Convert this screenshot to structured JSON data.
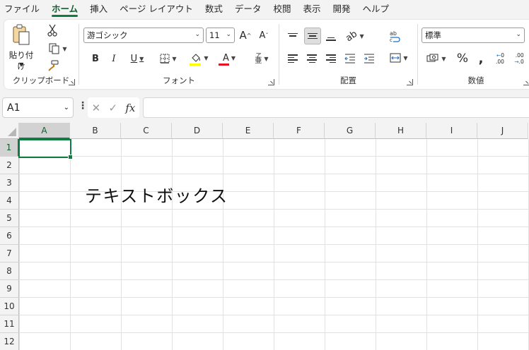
{
  "menu": {
    "tabs": [
      "ファイル",
      "ホーム",
      "挿入",
      "ページ レイアウト",
      "数式",
      "データ",
      "校閲",
      "表示",
      "開発",
      "ヘルプ"
    ],
    "active_tab": "ホーム"
  },
  "ribbon": {
    "clipboard": {
      "paste_label": "貼り付け",
      "group_label": "クリップボード"
    },
    "font": {
      "font_name": "游ゴシック",
      "font_size": "11",
      "group_label": "フォント"
    },
    "alignment": {
      "group_label": "配置"
    },
    "number": {
      "format": "標準",
      "group_label": "数値"
    }
  },
  "formula_bar": {
    "name_box": "A1",
    "fx_label": "fx",
    "content": ""
  },
  "sheet": {
    "columns": [
      "A",
      "B",
      "C",
      "D",
      "E",
      "F",
      "G",
      "H",
      "I",
      "J"
    ],
    "rows": [
      "1",
      "2",
      "3",
      "4",
      "5",
      "6",
      "7",
      "8",
      "9",
      "10",
      "11",
      "12"
    ],
    "selected_cell": "A1",
    "textbox_text": "テキストボックス"
  },
  "colors": {
    "accent": "#107c41",
    "font_color_bar": "#e81123",
    "highlight_bar": "#ffff00"
  }
}
